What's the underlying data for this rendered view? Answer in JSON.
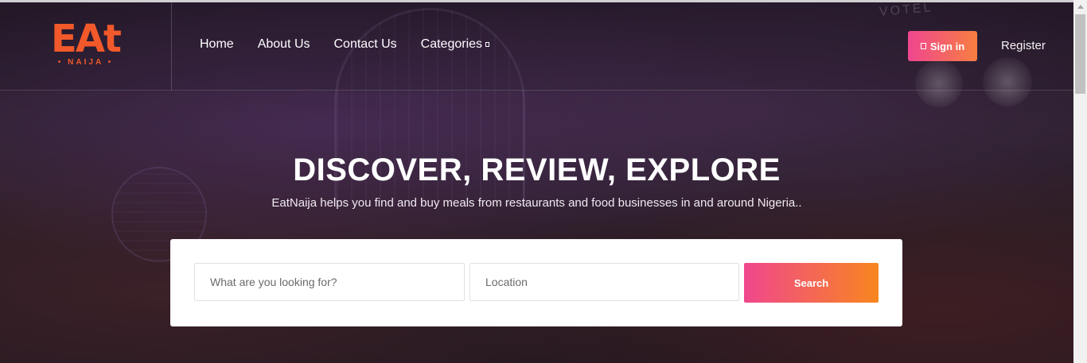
{
  "header": {
    "logo_text": "EAt",
    "logo_subtitle": "• NAIJA •",
    "nav": [
      {
        "label": "Home"
      },
      {
        "label": "About Us"
      },
      {
        "label": "Contact Us"
      },
      {
        "label": "Categories"
      }
    ],
    "signin_label": "Sign in",
    "register_label": "Register"
  },
  "hero": {
    "headline": "DISCOVER, REVIEW, EXPLORE",
    "subline": "EatNaija helps you find and buy meals from restaurants and food businesses in and around Nigeria..",
    "background_sign": "VOTEL"
  },
  "search": {
    "what_placeholder": "What are you looking for?",
    "location_placeholder": "Location",
    "button_label": "Search"
  },
  "colors": {
    "brand": "#f2592a",
    "button_gradient_start": "#f0478d",
    "button_gradient_end": "#f8861f"
  }
}
